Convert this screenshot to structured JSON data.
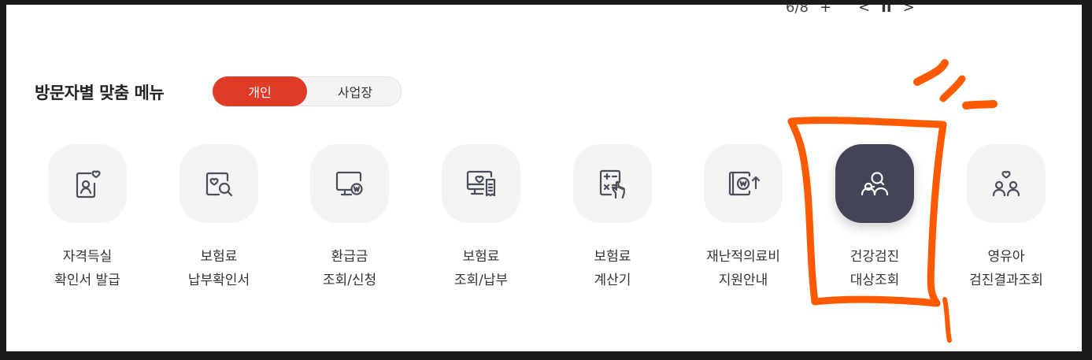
{
  "pager": {
    "count": "6/8",
    "plus": "+",
    "prev": "<",
    "pause": "II",
    "next": ">"
  },
  "section": {
    "title": "방문자별 맞춤 메뉴"
  },
  "visitor_toggle": {
    "options": [
      "개인",
      "사업장"
    ],
    "selected": "개인"
  },
  "menu_items": [
    {
      "line1": "자격득실",
      "line2": "확인서 발급",
      "icon": "id-card-heart-icon"
    },
    {
      "line1": "보험료",
      "line2": "납부확인서",
      "icon": "heart-search-icon"
    },
    {
      "line1": "환급금",
      "line2": "조회/신청",
      "icon": "monitor-won-icon"
    },
    {
      "line1": "보험료",
      "line2": "조회/납부",
      "icon": "monitor-receipt-icon"
    },
    {
      "line1": "보험료",
      "line2": "계산기",
      "icon": "calculator-hand-icon"
    },
    {
      "line1": "재난적의료비",
      "line2": "지원안내",
      "icon": "wallet-won-up-icon"
    },
    {
      "line1": "건강검진",
      "line2": "대상조회",
      "icon": "people-search-icon",
      "active": true
    },
    {
      "line1": "영유아",
      "line2": "검진결과조회",
      "icon": "family-heart-icon"
    }
  ],
  "colors": {
    "accent": "#e03b29",
    "active_tile": "#434557",
    "tile": "#f4f4f4",
    "annotation": "#ff5a00"
  }
}
